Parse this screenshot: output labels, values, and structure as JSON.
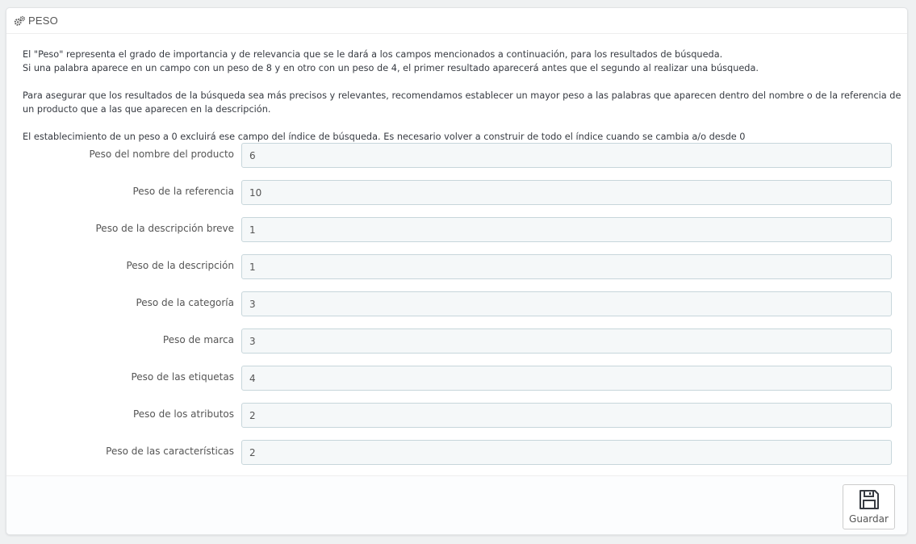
{
  "panel": {
    "title": "PESO",
    "icon": "gears-icon"
  },
  "description": {
    "line1": "El \"Peso\" representa el grado de importancia y de relevancia que se le dará a los campos mencionados a continuación, para los resultados de búsqueda.",
    "line2": "Si una palabra aparece en un campo con un peso de 8 y en otro con un peso de 4, el primer resultado aparecerá antes que el segundo al realizar una búsqueda.",
    "line3": "Para asegurar que los resultados de la búsqueda sea más precisos y relevantes, recomendamos establecer un mayor peso a las palabras que aparecen dentro del nombre o de la referencia de un producto que a las que aparecen en la descripción.",
    "line4": "El establecimiento de un peso a 0 excluirá ese campo del índice de búsqueda. Es necesario volver a construir de todo el índice cuando se cambia a/o desde 0"
  },
  "fields": [
    {
      "label": "Peso del nombre del producto",
      "value": "6"
    },
    {
      "label": "Peso de la referencia",
      "value": "10"
    },
    {
      "label": "Peso de la descripción breve",
      "value": "1"
    },
    {
      "label": "Peso de la descripción",
      "value": "1"
    },
    {
      "label": "Peso de la categoría",
      "value": "3"
    },
    {
      "label": "Peso de marca",
      "value": "3"
    },
    {
      "label": "Peso de las etiquetas",
      "value": "4"
    },
    {
      "label": "Peso de los atributos",
      "value": "2"
    },
    {
      "label": "Peso de las características",
      "value": "2"
    }
  ],
  "footer": {
    "save_label": "Guardar",
    "save_icon": "floppy-disk-icon"
  }
}
